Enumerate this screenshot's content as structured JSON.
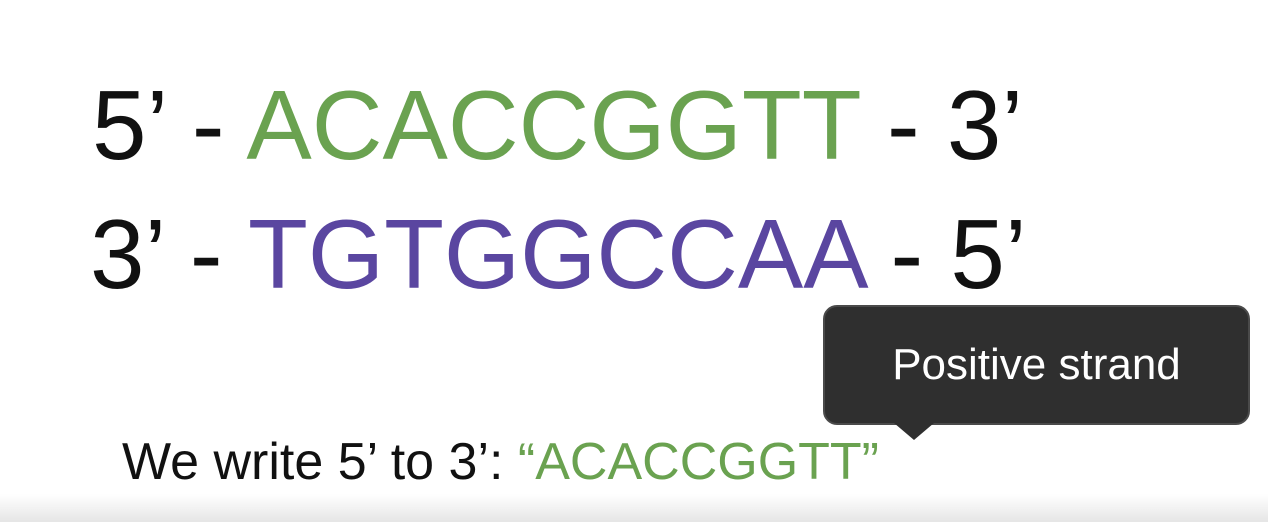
{
  "sequences": {
    "top": {
      "left_end": "5’",
      "dash_left": "-",
      "bases": "ACACCGGTT",
      "dash_right": "-",
      "right_end": "3’"
    },
    "bottom": {
      "left_end": "3’",
      "dash_left": "-",
      "bases": "TGTGGCCAA",
      "dash_right": "-",
      "right_end": "5’"
    }
  },
  "caption": {
    "prefix": "We write 5’ to 3’: ",
    "quoted": "“ACACCGGTT”"
  },
  "tooltip": {
    "text": "Positive strand"
  },
  "colors": {
    "green": "#6aa250",
    "purple": "#5a46a0",
    "tooltip_bg": "#2f2f2f"
  }
}
